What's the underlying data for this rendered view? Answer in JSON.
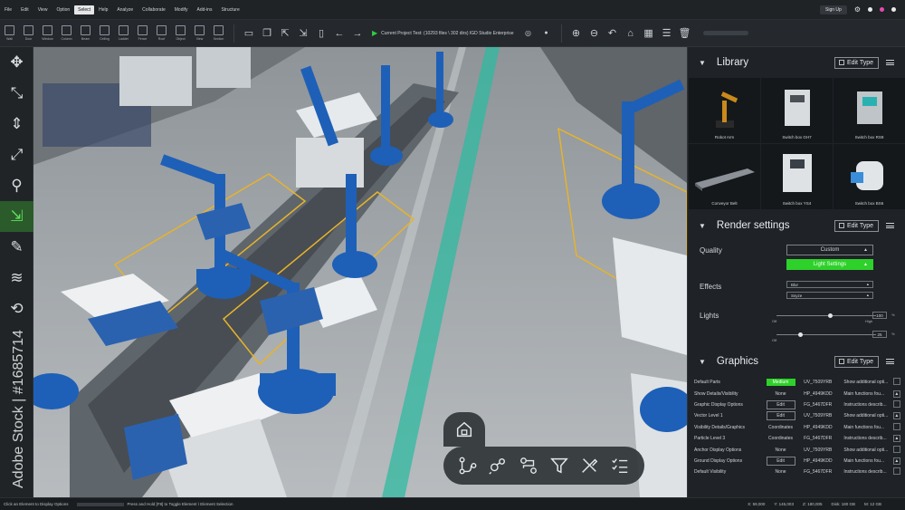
{
  "menubar": {
    "items": [
      "File",
      "Edit",
      "View",
      "Option",
      "Select",
      "Help",
      "Analyze",
      "Collaborate",
      "Modify",
      "Add-ins",
      "Structure"
    ],
    "active_index": 4,
    "signup": "Sign Up"
  },
  "toolbar": {
    "tools": [
      "Wall",
      "Door",
      "Window",
      "Column",
      "Beam",
      "Ceiling",
      "Ladder",
      "Fence",
      "Roof",
      "Object",
      "View",
      "Section"
    ],
    "status": "Current Project Test: (10293 files \\ 302 dirs) IGD Studio Enterprise"
  },
  "left_tools": [
    {
      "icon": "move-icon",
      "glyph": "✥"
    },
    {
      "icon": "rotate-icon",
      "glyph": "⤡"
    },
    {
      "icon": "align-vertical-icon",
      "glyph": "⇕"
    },
    {
      "icon": "scale-icon",
      "glyph": "⤢"
    },
    {
      "icon": "pin-icon",
      "glyph": "⚲"
    },
    {
      "icon": "expand-icon",
      "glyph": "⇲",
      "active": true
    },
    {
      "icon": "node-edit-icon",
      "glyph": "✎"
    },
    {
      "icon": "layers-icon",
      "glyph": "≋"
    },
    {
      "icon": "extra-tool-icon",
      "glyph": "⟲"
    }
  ],
  "library": {
    "title": "Library",
    "edit_label": "Edit Type",
    "items": [
      {
        "label": "Robot Arm",
        "icon": "robot-arm-icon"
      },
      {
        "label": "Switch box GH7",
        "icon": "switch-box-icon"
      },
      {
        "label": "Switch box RS9",
        "icon": "switch-box-icon"
      },
      {
        "label": "Conveyor Belt",
        "icon": "conveyor-belt-icon"
      },
      {
        "label": "Switch box YS4",
        "icon": "switch-box-icon"
      },
      {
        "label": "Switch box BS6",
        "icon": "switch-box-icon"
      }
    ]
  },
  "render": {
    "title": "Render settings",
    "edit_label": "Edit Type",
    "quality_label": "Quality",
    "quality_value": "Custom",
    "light_settings": "Light Settings",
    "effects_label": "Effects",
    "effects": [
      "Blur",
      "Ssyze"
    ],
    "lights_label": "Lights",
    "light1": {
      "value": "100",
      "unit": "%",
      "low": "Off",
      "high": "High",
      "level": 0.9
    },
    "light2": {
      "value": "25",
      "unit": "%",
      "low": "Off",
      "level": 0.25
    }
  },
  "graphics": {
    "title": "Graphics",
    "edit_label": "Edit Type",
    "rows": [
      {
        "name": "Default Parts",
        "value": "Medium",
        "style": "green",
        "code": "UV_7509YRB",
        "desc": "Show additional opti..."
      },
      {
        "name": "Show Details/Visibility",
        "value": "None",
        "style": "plain",
        "code": "HP_4949KDD",
        "desc": "Main functions fou..."
      },
      {
        "name": "Graphic Display Options",
        "value": "Edit",
        "style": "btn",
        "code": "FG_5467DFR",
        "desc": "Instructions describ..."
      },
      {
        "name": "Vector Level 1",
        "value": "Edit",
        "style": "btn",
        "code": "UV_7509YRB",
        "desc": "Show additional opti..."
      },
      {
        "name": "Visibility Details/Graphics",
        "value": "Coordinates",
        "style": "plain",
        "code": "HP_4949KDD",
        "desc": "Main functions fou..."
      },
      {
        "name": "Particle Level 3",
        "value": "Coordinates",
        "style": "plain",
        "code": "FG_5467DFR",
        "desc": "Instructions describ..."
      },
      {
        "name": "Anchor Display Options",
        "value": "None",
        "style": "plain",
        "code": "UV_7509YRB",
        "desc": "Show additional opti..."
      },
      {
        "name": "Ground Display Options",
        "value": "Edit",
        "style": "btn",
        "code": "HP_4949KDD",
        "desc": "Main functions fou..."
      },
      {
        "name": "Default Visibility",
        "value": "None",
        "style": "plain",
        "code": "FG_5467DFR",
        "desc": "Instructions describ..."
      }
    ]
  },
  "statusbar": {
    "left": "Click an Element to Display Options",
    "middle": "Press and Hold [F8] to Toggle Element \\ Element Selection",
    "right": [
      "X: 59,000",
      "Y: 146,003",
      "Z: 180,005",
      "Disk: 180 GB",
      "M: 12 GB"
    ]
  },
  "watermark": "Adobe Stock | #1685714"
}
